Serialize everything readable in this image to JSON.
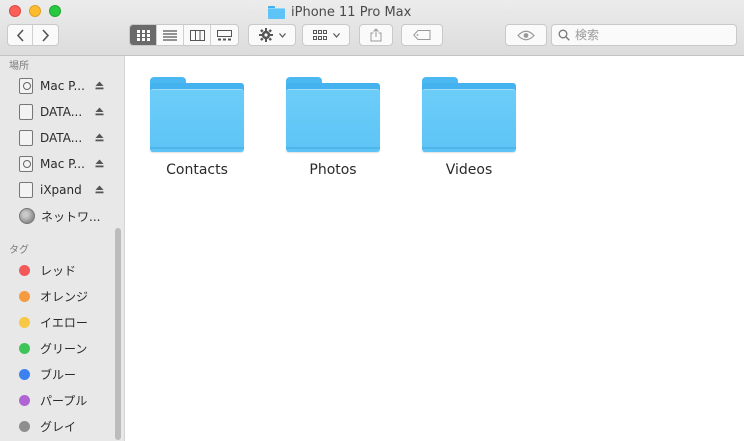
{
  "window": {
    "title": "iPhone 11 Pro Max"
  },
  "toolbar": {
    "search_placeholder": "検索"
  },
  "sidebar": {
    "locations_header": "場所",
    "locations": [
      {
        "label": "Mac P...",
        "icon": "time-machine-drive-icon",
        "eject": true
      },
      {
        "label": "DATA...",
        "icon": "drive-icon",
        "eject": true
      },
      {
        "label": "DATA...",
        "icon": "drive-icon",
        "eject": true
      },
      {
        "label": "Mac P...",
        "icon": "time-machine-drive-icon",
        "eject": true
      },
      {
        "label": "iXpand",
        "icon": "drive-icon",
        "eject": true
      },
      {
        "label": "ネットワ...",
        "icon": "network-icon",
        "eject": false
      }
    ],
    "tags_header": "タグ",
    "tags": [
      {
        "label": "レッド",
        "color": "#f25a5a"
      },
      {
        "label": "オレンジ",
        "color": "#f69a3f"
      },
      {
        "label": "イエロー",
        "color": "#f8c744"
      },
      {
        "label": "グリーン",
        "color": "#3dc55a"
      },
      {
        "label": "ブルー",
        "color": "#3b82f0"
      },
      {
        "label": "パープル",
        "color": "#b065d3"
      },
      {
        "label": "グレイ",
        "color": "#8e8e8e"
      }
    ]
  },
  "main": {
    "folders": [
      {
        "label": "Contacts"
      },
      {
        "label": "Photos"
      },
      {
        "label": "Videos"
      }
    ]
  },
  "colors": {
    "folder": "#5ec3f6",
    "active_view_button": "#6a6a6a"
  }
}
